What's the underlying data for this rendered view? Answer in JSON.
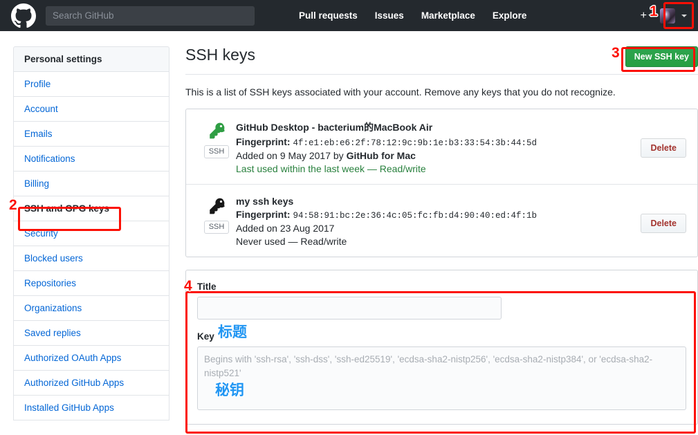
{
  "header": {
    "logo_icon": "github-mark-icon",
    "search_placeholder": "Search GitHub",
    "nav": [
      {
        "label": "Pull requests"
      },
      {
        "label": "Issues"
      },
      {
        "label": "Marketplace"
      },
      {
        "label": "Explore"
      }
    ],
    "plus_label": "+",
    "plus_icon": "plus-caret-icon",
    "avatar_icon": "user-avatar",
    "avatar_caret_icon": "chevron-down-icon"
  },
  "sidebar": {
    "heading": "Personal settings",
    "items": [
      {
        "label": "Profile",
        "active": false
      },
      {
        "label": "Account",
        "active": false
      },
      {
        "label": "Emails",
        "active": false
      },
      {
        "label": "Notifications",
        "active": false
      },
      {
        "label": "Billing",
        "active": false
      },
      {
        "label": "SSH and GPG keys",
        "active": true
      },
      {
        "label": "Security",
        "active": false
      },
      {
        "label": "Blocked users",
        "active": false
      },
      {
        "label": "Repositories",
        "active": false
      },
      {
        "label": "Organizations",
        "active": false
      },
      {
        "label": "Saved replies",
        "active": false
      },
      {
        "label": "Authorized OAuth Apps",
        "active": false
      },
      {
        "label": "Authorized GitHub Apps",
        "active": false
      },
      {
        "label": "Installed GitHub Apps",
        "active": false
      }
    ]
  },
  "main": {
    "title": "SSH keys",
    "new_key_button": "New SSH key",
    "intro": "This is a list of SSH keys associated with your account. Remove any keys that you do not recognize.",
    "keys": [
      {
        "title": "GitHub Desktop - bacterium的MacBook Air",
        "fingerprint_label": "Fingerprint:",
        "fingerprint": "4f:e1:eb:e6:2f:78:12:9c:9b:1e:b3:33:54:3b:44:5d",
        "added_prefix": "Added on 9 May 2017 by ",
        "added_by": "GitHub for Mac",
        "usage": "Last used within the last week — Read/write",
        "usage_state": "green",
        "badge": "SSH",
        "key_icon": "key-icon-green",
        "delete_label": "Delete"
      },
      {
        "title": "my ssh keys",
        "fingerprint_label": "Fingerprint:",
        "fingerprint": "94:58:91:bc:2e:36:4c:05:fc:fb:d4:90:40:ed:4f:1b",
        "added_prefix": "Added on 23 Aug 2017",
        "added_by": "",
        "usage": "Never used — Read/write",
        "usage_state": "gray",
        "badge": "SSH",
        "key_icon": "key-icon-black",
        "delete_label": "Delete"
      }
    ],
    "form": {
      "title_label": "Title",
      "title_value": "",
      "key_label": "Key",
      "key_placeholder": "Begins with 'ssh-rsa', 'ssh-dss', 'ssh-ed25519', 'ecdsa-sha2-nistp256', 'ecdsa-sha2-nistp384', or 'ecdsa-sha2-nistp521'"
    }
  },
  "annotations": {
    "numbers": [
      {
        "id": "1",
        "text": "1"
      },
      {
        "id": "2",
        "text": "2"
      },
      {
        "id": "3",
        "text": "3"
      },
      {
        "id": "4",
        "text": "4"
      }
    ],
    "chinese": [
      {
        "id": "title-cn",
        "text": "标题"
      },
      {
        "id": "key-cn",
        "text": "秘钥"
      }
    ],
    "box_color": "#fc1005",
    "cn_color": "#2196f3"
  }
}
